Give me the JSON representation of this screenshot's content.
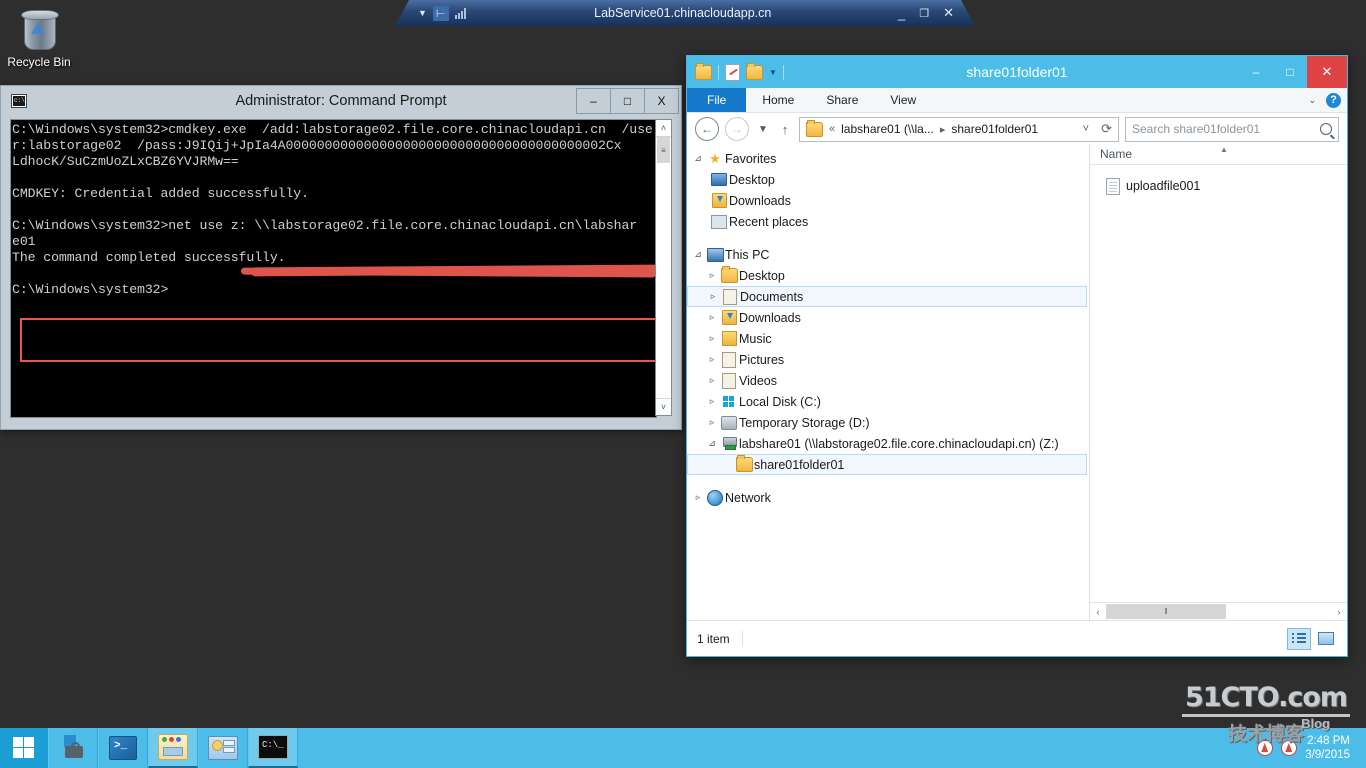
{
  "desktop": {
    "recycle_bin_label": "Recycle Bin",
    "background_color": "#2e2e2e"
  },
  "rdp_bar": {
    "title": "LabService01.chinacloudapp.cn",
    "pin_icon": "pin-icon",
    "connection_icon": "signal-bars-icon",
    "dropdown_icon": "chevron-down-icon",
    "minimize": "_",
    "restore": "❐",
    "close": "✕"
  },
  "cmd_window": {
    "title": "Administrator: Command Prompt",
    "icon": "console-icon",
    "minimize": "–",
    "maximize": "□",
    "close": "X",
    "console_text": "C:\\Windows\\system32>cmdkey.exe  /add:labstorage02.file.core.chinacloudapi.cn  /use\nr:labstorage02  /pass:J9IQij+JpIa4A00000000000000000000000000000000000000002Cx\nLdhocK/SuCzmUoZLxCBZ6YVJRMw==\n\nCMDKEY: Credential added successfully.\n\nC:\\Windows\\system32>net use z: \\\\labstorage02.file.core.chinacloudapi.cn\\labshar\ne01\nThe command completed successfully.\n\nC:\\Windows\\system32>",
    "highlight_color": "#e8564c",
    "redaction_color": "#e0554b",
    "scroll_up": "˄",
    "scroll_down": "˅",
    "scroll_thumb": "≡"
  },
  "explorer": {
    "title": "share01folder01",
    "quick_access": {
      "folder_icon": "folder-icon",
      "properties_icon": "properties-icon",
      "new_folder_icon": "new-folder-icon",
      "customize_icon": "chevron-down-icon"
    },
    "window_controls": {
      "minimize": "–",
      "maximize": "□",
      "close": "✕"
    },
    "ribbon_tabs": [
      {
        "label": "File",
        "active": true
      },
      {
        "label": "Home",
        "active": false
      },
      {
        "label": "Share",
        "active": false
      },
      {
        "label": "View",
        "active": false
      }
    ],
    "ribbon_right": {
      "expand_icon": "chevron-down-icon",
      "help_icon": "help-icon",
      "help_glyph": "?"
    },
    "address_bar": {
      "back_icon": "back-arrow-icon",
      "forward_icon": "forward-arrow-icon",
      "recent_icon": "chevron-down-icon",
      "up_icon": "up-arrow-icon",
      "folder_icon": "folder-icon",
      "overflow": "«",
      "crumb_1": "labshare01 (\\\\la...",
      "crumb_sep": "▸",
      "crumb_2": "share01folder01",
      "dropdown": "˅",
      "refresh": "⟳"
    },
    "search": {
      "placeholder": "Search share01folder01",
      "value": "",
      "icon": "search-icon"
    },
    "nav_tree": [
      {
        "label": "Favorites",
        "icon": "star-icon",
        "indent": 0,
        "twisty": "⊿",
        "selected": false
      },
      {
        "label": "Desktop",
        "icon": "monitor-icon",
        "indent": 1,
        "twisty": "",
        "selected": false
      },
      {
        "label": "Downloads",
        "icon": "downloads-icon",
        "indent": 1,
        "twisty": "",
        "selected": false
      },
      {
        "label": "Recent places",
        "icon": "recent-places-icon",
        "indent": 1,
        "twisty": "",
        "selected": false
      },
      {
        "label": "This PC",
        "icon": "computer-icon",
        "indent": 0,
        "twisty": "⊿",
        "selected": false
      },
      {
        "label": "Desktop",
        "icon": "folder-icon",
        "indent": 1,
        "twisty": "▹",
        "selected": false
      },
      {
        "label": "Documents",
        "icon": "documents-icon",
        "indent": 1,
        "twisty": "▹",
        "selected": true
      },
      {
        "label": "Downloads",
        "icon": "downloads-icon",
        "indent": 1,
        "twisty": "▹",
        "selected": false
      },
      {
        "label": "Music",
        "icon": "music-icon",
        "indent": 1,
        "twisty": "▹",
        "selected": false
      },
      {
        "label": "Pictures",
        "icon": "pictures-icon",
        "indent": 1,
        "twisty": "▹",
        "selected": false
      },
      {
        "label": "Videos",
        "icon": "videos-icon",
        "indent": 1,
        "twisty": "▹",
        "selected": false
      },
      {
        "label": "Local Disk (C:)",
        "icon": "local-disk-icon",
        "indent": 1,
        "twisty": "▹",
        "selected": false
      },
      {
        "label": "Temporary Storage (D:)",
        "icon": "drive-icon",
        "indent": 1,
        "twisty": "▹",
        "selected": false
      },
      {
        "label": "labshare01 (\\\\labstorage02.file.core.chinacloudapi.cn) (Z:)",
        "icon": "network-drive-icon",
        "indent": 1,
        "twisty": "⊿",
        "selected": false
      },
      {
        "label": "share01folder01",
        "icon": "folder-icon",
        "indent": 2,
        "twisty": "",
        "selected": true
      },
      {
        "label": "Network",
        "icon": "network-icon",
        "indent": 0,
        "twisty": "▹",
        "selected": false
      }
    ],
    "file_list": {
      "column_header": "Name",
      "sort_indicator": "▲",
      "items": [
        {
          "name": "uploadfile001",
          "icon": "file-icon"
        }
      ]
    },
    "hscroll": {
      "left_arrow": "‹",
      "right_arrow": "›",
      "grip": "‖"
    },
    "status_bar": {
      "item_count": "1 item",
      "details_view_icon": "details-view-icon",
      "large_icons_view_icon": "large-icons-view-icon"
    }
  },
  "taskbar": {
    "start_icon": "windows-logo-icon",
    "items": [
      {
        "icon": "server-manager-icon",
        "name": "server-manager",
        "active": false
      },
      {
        "icon": "powershell-icon",
        "name": "powershell",
        "active": false
      },
      {
        "icon": "file-explorer-icon",
        "name": "file-explorer",
        "active": true
      },
      {
        "icon": "control-panel-icon",
        "name": "control-panel",
        "active": false
      },
      {
        "icon": "command-prompt-icon",
        "name": "command-prompt",
        "active": true
      }
    ],
    "tray": {
      "icon_1": "action-center-icon",
      "icon_2": "network-warning-icon",
      "time": "2:48 PM",
      "date": "3/9/2015"
    }
  },
  "watermark": {
    "line1": "51CTO.com",
    "line2": "技术博客",
    "line3": "Blog"
  }
}
